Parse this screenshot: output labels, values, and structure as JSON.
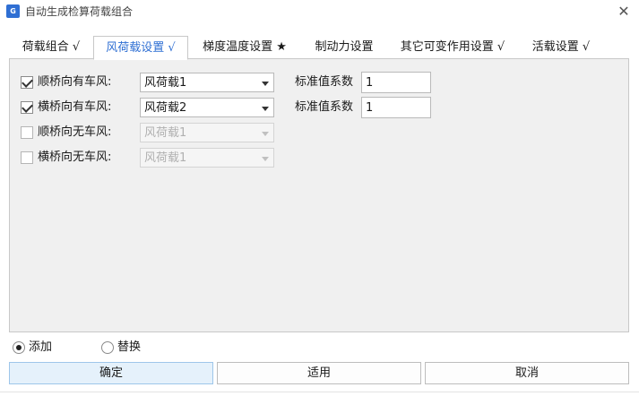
{
  "window": {
    "title": "自动生成检算荷载组合",
    "icon_text": "G"
  },
  "tabs": [
    {
      "label": "荷载组合 √"
    },
    {
      "label": "风荷载设置 √"
    },
    {
      "label": "梯度温度设置 ★"
    },
    {
      "label": "制动力设置"
    },
    {
      "label": "其它可变作用设置 √"
    },
    {
      "label": "活载设置 √"
    }
  ],
  "wind": {
    "rows": [
      {
        "label": "顺桥向有车风:",
        "checked": true,
        "load": "风荷载1",
        "enabled": true,
        "coef_label": "标准值系数",
        "coef": "1"
      },
      {
        "label": "横桥向有车风:",
        "checked": true,
        "load": "风荷载2",
        "enabled": true,
        "coef_label": "标准值系数",
        "coef": "1"
      },
      {
        "label": "顺桥向无车风:",
        "checked": false,
        "load": "风荷载1",
        "enabled": false
      },
      {
        "label": "横桥向无车风:",
        "checked": false,
        "load": "风荷载1",
        "enabled": false
      }
    ]
  },
  "mode": {
    "add_label": "添加",
    "replace_label": "替换",
    "selected": "add"
  },
  "buttons": {
    "ok": "确定",
    "apply": "适用",
    "cancel": "取消"
  },
  "icons": {
    "close": "close-icon",
    "dropdown": "chevron-down-icon",
    "app": "app-icon"
  },
  "colors": {
    "accent": "#2f6fd3",
    "panel_bg": "#f0f0f0",
    "primary_button_bg": "#e5f1fb"
  }
}
